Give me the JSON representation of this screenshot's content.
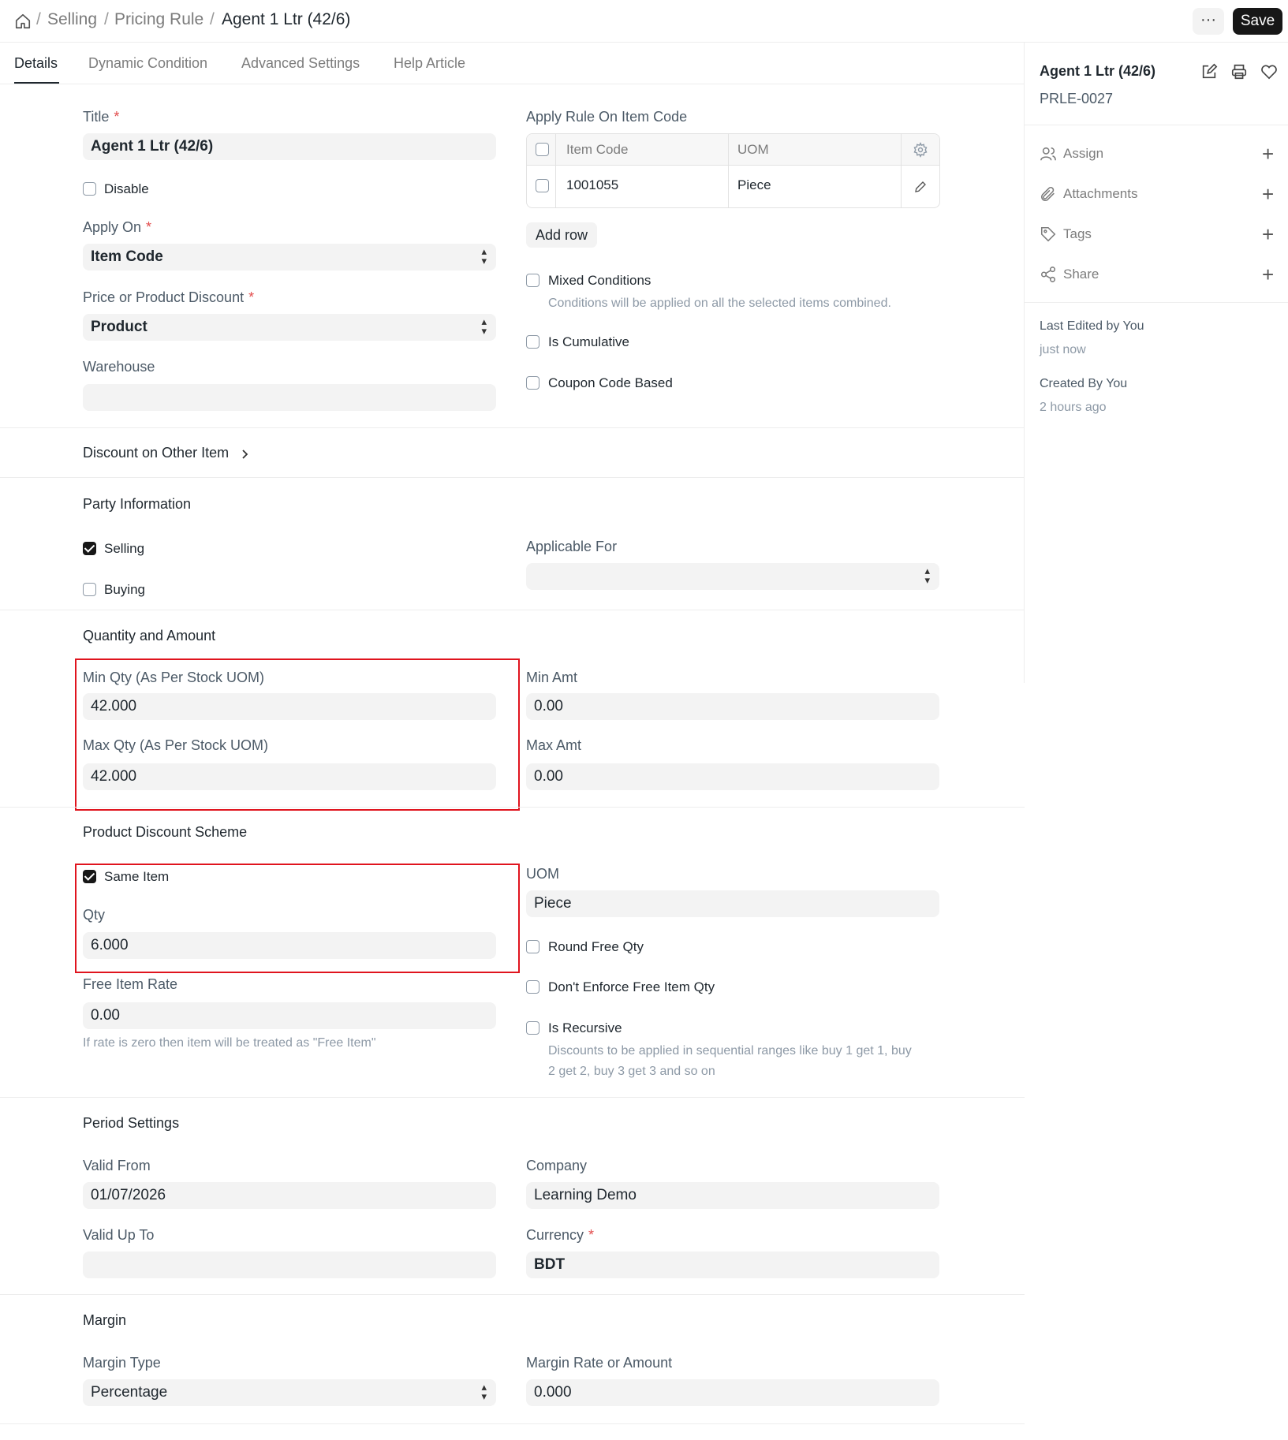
{
  "breadcrumb": {
    "items": [
      "Selling",
      "Pricing Rule"
    ],
    "current": "Agent 1 Ltr (42/6)"
  },
  "toolbar": {
    "more_label": "···",
    "save_label": "Save"
  },
  "tabs": [
    "Details",
    "Dynamic Condition",
    "Advanced Settings",
    "Help Article"
  ],
  "details": {
    "title": {
      "label": "Title",
      "value": "Agent 1 Ltr (42/6)"
    },
    "disable": {
      "label": "Disable",
      "checked": false
    },
    "apply_on": {
      "label": "Apply On",
      "value": "Item Code"
    },
    "price_or_product": {
      "label": "Price or Product Discount",
      "value": "Product"
    },
    "warehouse": {
      "label": "Warehouse",
      "value": ""
    },
    "apply_rule_on_item_code": {
      "label": "Apply Rule On Item Code",
      "columns": [
        "Item Code",
        "UOM"
      ],
      "rows": [
        {
          "item_code": "1001055",
          "uom": "Piece"
        }
      ],
      "add_row_label": "Add row"
    },
    "mixed_conditions": {
      "label": "Mixed Conditions",
      "help": "Conditions will be applied on all the selected items combined."
    },
    "is_cumulative": {
      "label": "Is Cumulative"
    },
    "coupon_code_based": {
      "label": "Coupon Code Based"
    }
  },
  "discount_on_other_item": {
    "label": "Discount on Other Item"
  },
  "party_information": {
    "title": "Party Information",
    "selling": {
      "label": "Selling",
      "checked": true
    },
    "buying": {
      "label": "Buying",
      "checked": false
    },
    "applicable_for": {
      "label": "Applicable For",
      "value": ""
    }
  },
  "quantity_and_amount": {
    "title": "Quantity and Amount",
    "min_qty": {
      "label": "Min Qty (As Per Stock UOM)",
      "value": "42.000"
    },
    "max_qty": {
      "label": "Max Qty (As Per Stock UOM)",
      "value": "42.000"
    },
    "min_amt": {
      "label": "Min Amt",
      "value": "0.00"
    },
    "max_amt": {
      "label": "Max Amt",
      "value": "0.00"
    }
  },
  "product_discount_scheme": {
    "title": "Product Discount Scheme",
    "same_item": {
      "label": "Same Item",
      "checked": true
    },
    "qty": {
      "label": "Qty",
      "value": "6.000"
    },
    "free_item_rate": {
      "label": "Free Item Rate",
      "value": "0.00",
      "help": "If rate is zero then item will be treated as \"Free Item\""
    },
    "uom": {
      "label": "UOM",
      "value": "Piece"
    },
    "round_free_qty": {
      "label": "Round Free Qty"
    },
    "dont_enforce_free_item_qty": {
      "label": "Don't Enforce Free Item Qty"
    },
    "is_recursive": {
      "label": "Is Recursive",
      "help_line1": "Discounts to be applied in sequential ranges like buy 1 get 1, buy",
      "help_line2": "2 get 2, buy 3 get 3 and so on"
    }
  },
  "period_settings": {
    "title": "Period Settings",
    "valid_from": {
      "label": "Valid From",
      "value": "01/07/2026"
    },
    "valid_up_to": {
      "label": "Valid Up To",
      "value": ""
    },
    "company": {
      "label": "Company",
      "value": "Learning Demo"
    },
    "currency": {
      "label": "Currency",
      "value": "BDT"
    }
  },
  "margin": {
    "title": "Margin",
    "margin_type": {
      "label": "Margin Type",
      "value": "Percentage"
    },
    "margin_rate_or_amount": {
      "label": "Margin Rate or Amount",
      "value": "0.000"
    }
  },
  "sidebar": {
    "doc_title": "Agent 1 Ltr (42/6)",
    "doc_id": "PRLE-0027",
    "actions": [
      "Assign",
      "Attachments",
      "Tags",
      "Share"
    ],
    "last_edited_by": "Last Edited by You",
    "last_edited_time": "just now",
    "created_by": "Created By You",
    "created_time": "2 hours ago"
  },
  "colors": {
    "primary": "#171717",
    "required": "#e24c4c",
    "highlight": "#e0141e",
    "field_bg": "#f3f3f3"
  }
}
